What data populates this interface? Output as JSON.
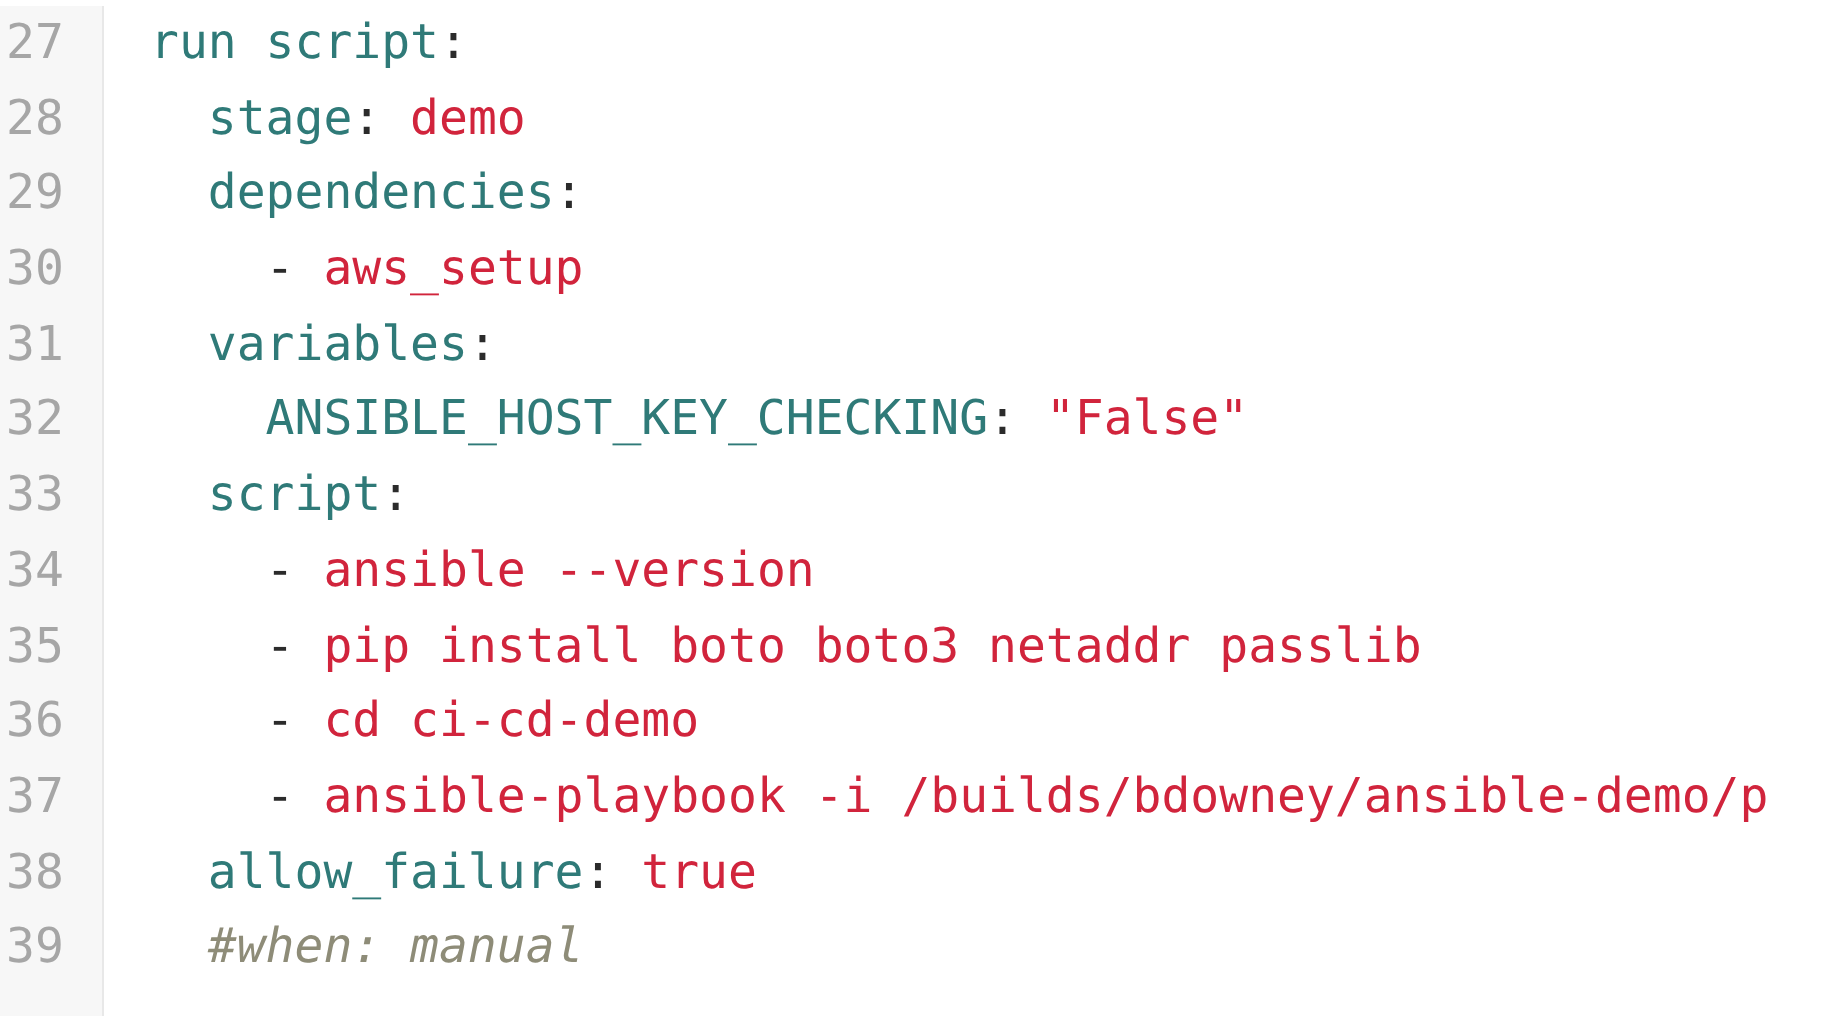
{
  "code_lines": [
    {
      "number": "27",
      "tokens": [
        {
          "kind": "key",
          "text": "run script"
        },
        {
          "kind": "punct",
          "text": ":"
        }
      ],
      "children": [
        {
          "number": "28",
          "tokens": [
            {
              "kind": "key",
              "text": "stage"
            },
            {
              "kind": "punct",
              "text": ": "
            },
            {
              "kind": "value",
              "text": "demo"
            }
          ]
        },
        {
          "number": "29",
          "tokens": [
            {
              "kind": "key",
              "text": "dependencies"
            },
            {
              "kind": "punct",
              "text": ":"
            }
          ],
          "children": [
            {
              "number": "30",
              "tokens": [
                {
                  "kind": "punct",
                  "text": "- "
                },
                {
                  "kind": "value",
                  "text": "aws_setup"
                }
              ]
            }
          ]
        },
        {
          "number": "31",
          "tokens": [
            {
              "kind": "key",
              "text": "variables"
            },
            {
              "kind": "punct",
              "text": ":"
            }
          ],
          "children": [
            {
              "number": "32",
              "tokens": [
                {
                  "kind": "key",
                  "text": "ANSIBLE_HOST_KEY_CHECKING"
                },
                {
                  "kind": "punct",
                  "text": ": "
                },
                {
                  "kind": "value",
                  "text": "\"False\""
                }
              ]
            }
          ]
        },
        {
          "number": "33",
          "tokens": [
            {
              "kind": "key",
              "text": "script"
            },
            {
              "kind": "punct",
              "text": ":"
            }
          ],
          "children": [
            {
              "number": "34",
              "tokens": [
                {
                  "kind": "punct",
                  "text": "- "
                },
                {
                  "kind": "value",
                  "text": "ansible --version"
                }
              ]
            },
            {
              "number": "35",
              "tokens": [
                {
                  "kind": "punct",
                  "text": "- "
                },
                {
                  "kind": "value",
                  "text": "pip install boto boto3 netaddr passlib"
                }
              ]
            },
            {
              "number": "36",
              "tokens": [
                {
                  "kind": "punct",
                  "text": "- "
                },
                {
                  "kind": "value",
                  "text": "cd ci-cd-demo"
                }
              ]
            },
            {
              "number": "37",
              "tokens": [
                {
                  "kind": "punct",
                  "text": "- "
                },
                {
                  "kind": "value",
                  "text": "ansible-playbook -i /builds/bdowney/ansible-demo/p"
                }
              ]
            }
          ]
        },
        {
          "number": "38",
          "tokens": [
            {
              "kind": "key",
              "text": "allow_failure"
            },
            {
              "kind": "punct",
              "text": ": "
            },
            {
              "kind": "value",
              "text": "true"
            }
          ]
        },
        {
          "number": "39",
          "tokens": [
            {
              "kind": "comment",
              "text": "#when: manual"
            }
          ]
        }
      ]
    }
  ]
}
